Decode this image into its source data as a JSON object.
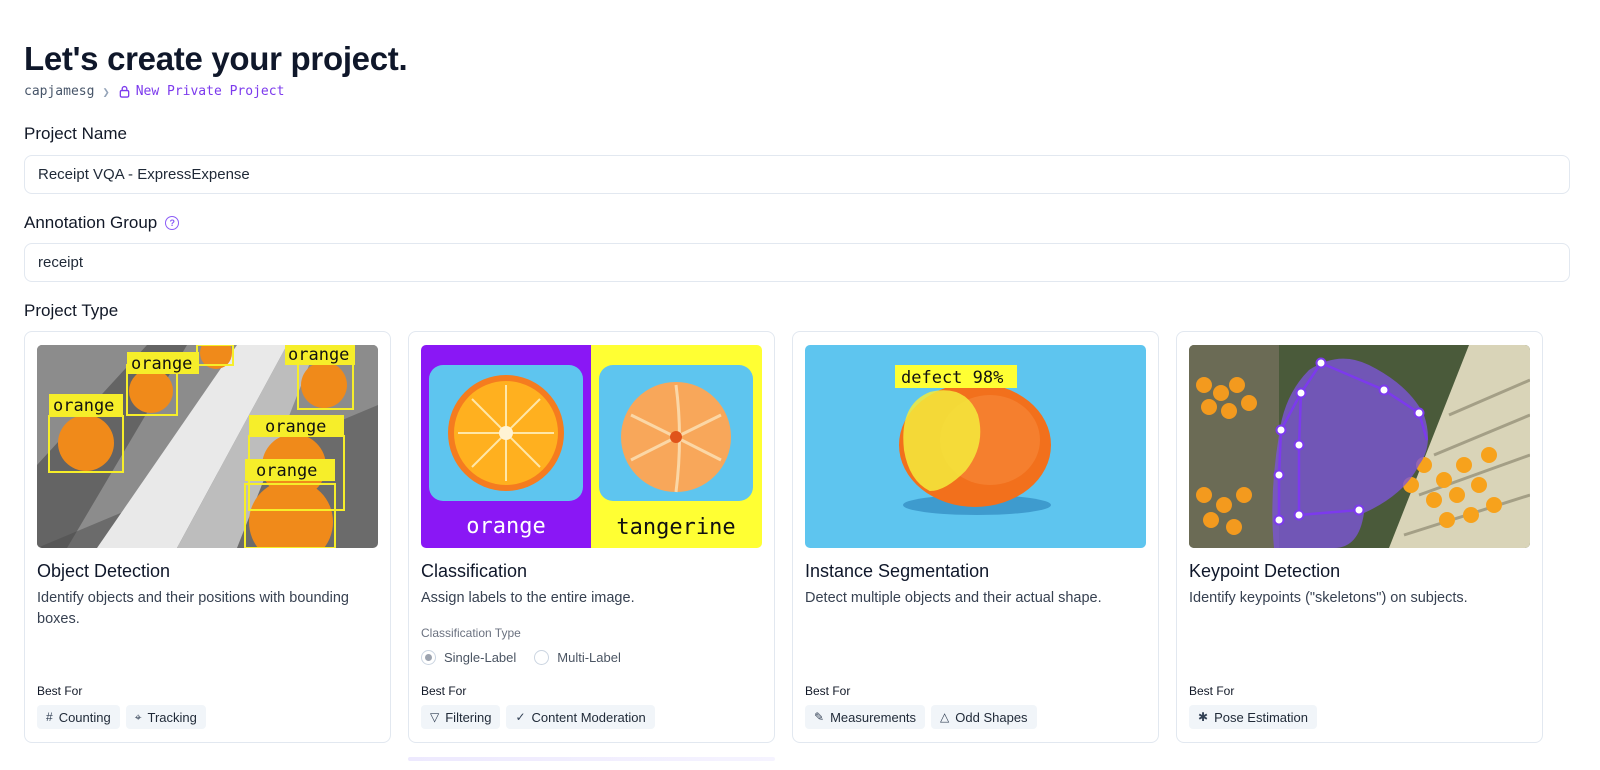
{
  "header": {
    "title": "Let's create your project.",
    "breadcrumb": {
      "owner": "capjamesg",
      "separator": ">",
      "project": "New Private Project"
    }
  },
  "form": {
    "project_name": {
      "label": "Project Name",
      "value": "Receipt VQA - ExpressExpense"
    },
    "annotation_group": {
      "label": "Annotation Group",
      "value": "receipt"
    },
    "project_type_label": "Project Type"
  },
  "cards": [
    {
      "title": "Object Detection",
      "description": "Identify objects and their positions with bounding boxes.",
      "best_for_label": "Best For",
      "tags": [
        {
          "icon": "hash-icon",
          "label": "Counting"
        },
        {
          "icon": "tracking-icon",
          "label": "Tracking"
        }
      ],
      "image_labels": [
        "orange",
        "orange",
        "orange",
        "orange",
        "orange"
      ]
    },
    {
      "title": "Classification",
      "description": "Assign labels to the entire image.",
      "classification_type_label": "Classification Type",
      "options": [
        "Single-Label",
        "Multi-Label"
      ],
      "selected_option": "Single-Label",
      "best_for_label": "Best For",
      "tags": [
        {
          "icon": "filter-icon",
          "label": "Filtering"
        },
        {
          "icon": "check-icon",
          "label": "Content Moderation"
        }
      ],
      "image_labels": [
        "orange",
        "tangerine"
      ]
    },
    {
      "title": "Instance Segmentation",
      "description": "Detect multiple objects and their actual shape.",
      "best_for_label": "Best For",
      "tags": [
        {
          "icon": "ruler-icon",
          "label": "Measurements"
        },
        {
          "icon": "shapes-icon",
          "label": "Odd Shapes"
        }
      ],
      "image_labels": [
        "defect 98%"
      ]
    },
    {
      "title": "Keypoint Detection",
      "description": "Identify keypoints (\"skeletons\") on subjects.",
      "best_for_label": "Best For",
      "tags": [
        {
          "icon": "person-running-icon",
          "label": "Pose Estimation"
        }
      ]
    }
  ],
  "colors": {
    "accent": "#7c3aed",
    "label_yellow": "#ffff33",
    "classification_purple": "#8a17f5",
    "sky_blue": "#5ec5ef",
    "orange": "#f57c1f"
  }
}
